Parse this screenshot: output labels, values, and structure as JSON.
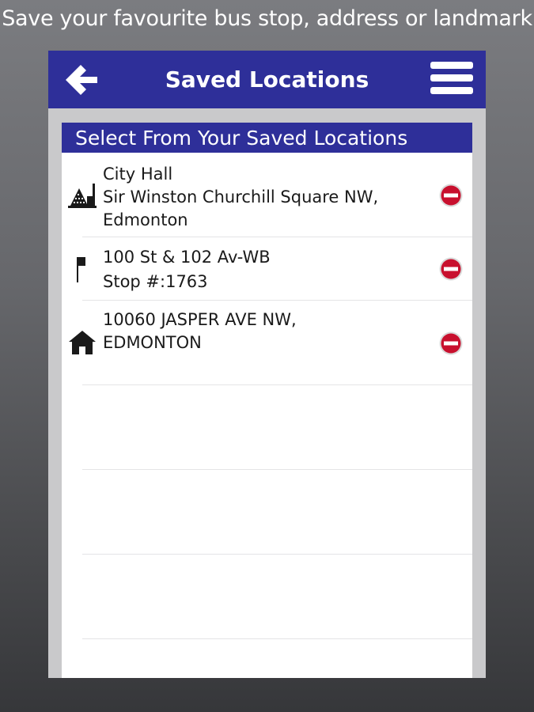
{
  "caption": "Save your favourite bus stop, address or landmark",
  "navbar": {
    "title": "Saved Locations",
    "back_icon": "arrow-left-icon",
    "menu_icon": "hamburger-menu-icon",
    "color": "#2e2f99"
  },
  "section": {
    "header": "Select From Your Saved Locations"
  },
  "locations": [
    {
      "type": "landmark",
      "icon": "landmark-building-icon",
      "lines": [
        "City Hall",
        "Sir Winston Churchill Square NW,",
        "Edmonton"
      ]
    },
    {
      "type": "bus-stop",
      "icon": "bus-stop-flag-icon",
      "lines": [
        "100 St & 102 Av-WB",
        "Stop #:1763"
      ]
    },
    {
      "type": "address",
      "icon": "house-icon",
      "lines": [
        "10060 JASPER AVE NW,",
        "EDMONTON"
      ]
    }
  ],
  "remove_icon": "remove-minus-icon",
  "colors": {
    "accent": "#2e2f99",
    "remove": "#c8102e"
  }
}
